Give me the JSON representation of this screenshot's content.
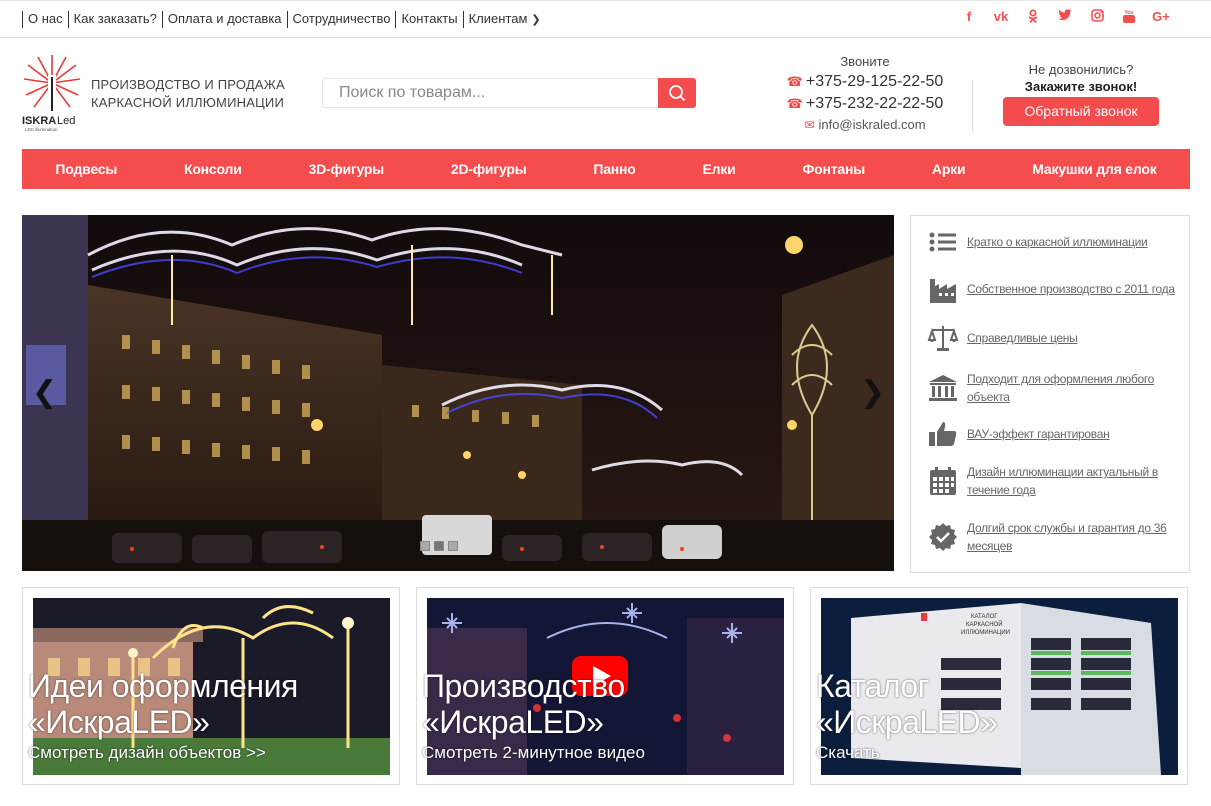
{
  "topbar": {
    "links": [
      "О нас",
      "Как заказать?",
      "Оплата и доставка",
      "Сотрудничество",
      "Контакты",
      "Клиентам"
    ],
    "social": [
      "f",
      "vk",
      "ok",
      "tw",
      "ig",
      "yt",
      "G+"
    ]
  },
  "header": {
    "logo_text": "ISKRALed",
    "logo_sub": "LED illumination",
    "tagline_line1": "ПРОИЗВОДСТВО И ПРОДАЖА",
    "tagline_line2": "КАРКАСНОЙ ИЛЛЮМИНАЦИИ",
    "search_placeholder": "Поиск по товарам...",
    "call_label": "Звоните",
    "phone1": "+375-29-125-22-50",
    "phone2": "+375-232-22-22-50",
    "email": "info@iskraled.com",
    "missed_label": "Не дозвонились?",
    "order_call_label": "Закажите звонок!",
    "callback_button": "Обратный звонок"
  },
  "nav": [
    "Подвесы",
    "Консоли",
    "3D-фигуры",
    "2D-фигуры",
    "Панно",
    "Елки",
    "Фонтаны",
    "Арки",
    "Макушки для елок"
  ],
  "features": [
    {
      "icon": "list-icon",
      "text": "Кратко о каркасной иллюминации"
    },
    {
      "icon": "factory-icon",
      "text": "Собственное производство с 2011 года"
    },
    {
      "icon": "scales-icon",
      "text": "Справедливые цены"
    },
    {
      "icon": "building-icon",
      "text": "Подходит для оформления любого объекта"
    },
    {
      "icon": "thumbs-up-icon",
      "text": "ВАУ-эффект гарантирован"
    },
    {
      "icon": "calendar-icon",
      "text": "Дизайн иллюминации актуальный в течение года"
    },
    {
      "icon": "badge-icon",
      "text": "Долгий срок службы и гарантия до 36 месяцев"
    }
  ],
  "cards": [
    {
      "title1": "Идеи оформления",
      "title2": "«ИскраLED»",
      "sub": "Смотреть дизайн объектов >>"
    },
    {
      "title1": "Производство",
      "title2": "«ИскраLED»",
      "sub": "Смотреть 2-минутное видео"
    },
    {
      "title1": "Каталог",
      "title2": "«ИскраLED»",
      "sub": "Скачать"
    }
  ],
  "colors": {
    "accent": "#f54d4d"
  }
}
